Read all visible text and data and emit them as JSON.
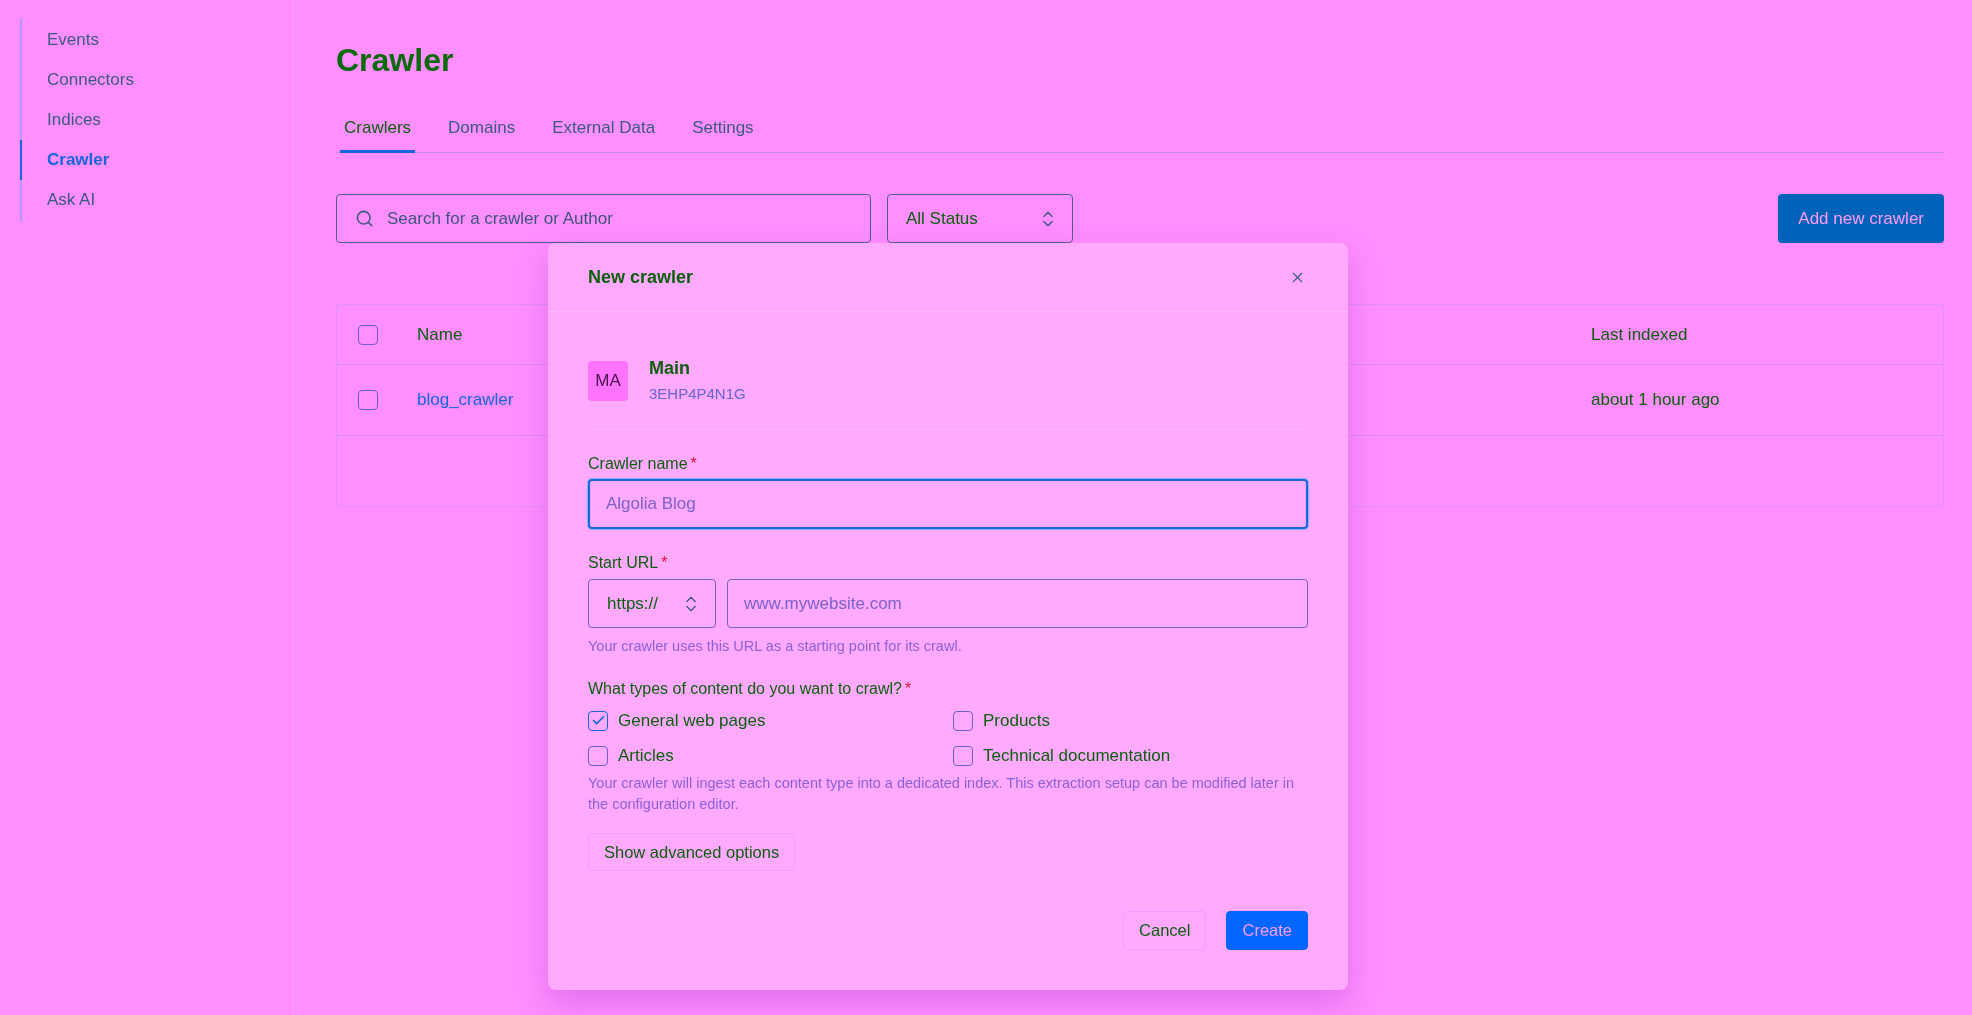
{
  "sidebar": {
    "items": [
      {
        "label": "Events",
        "selected": false
      },
      {
        "label": "Connectors",
        "selected": false
      },
      {
        "label": "Indices",
        "selected": false
      },
      {
        "label": "Crawler",
        "selected": true
      },
      {
        "label": "Ask AI",
        "selected": false
      }
    ]
  },
  "page": {
    "title": "Crawler"
  },
  "tabs": [
    {
      "label": "Crawlers",
      "selected": true
    },
    {
      "label": "Domains",
      "selected": false
    },
    {
      "label": "External Data",
      "selected": false
    },
    {
      "label": "Settings",
      "selected": false
    }
  ],
  "toolbar": {
    "search": {
      "placeholder": "Search for a crawler or Author"
    },
    "status_filter": {
      "value": "All Status"
    },
    "add_button": {
      "label": "Add new crawler"
    }
  },
  "table": {
    "select_all": {
      "checked": false
    },
    "columns": [
      "Name",
      "Last indexed"
    ],
    "rows": [
      {
        "checked": false,
        "name": "blog_crawler",
        "last_indexed": "about 1 hour ago"
      }
    ]
  },
  "modal": {
    "title": "New crawler",
    "account": {
      "initials": "MA",
      "name": "Main",
      "id": "3EHP4P4N1G"
    },
    "crawler_name": {
      "label": "Crawler name",
      "required_mark": "*",
      "placeholder": "Algolia Blog",
      "focused": true
    },
    "start_url": {
      "label": "Start URL",
      "required_mark": "*",
      "protocol": "https://",
      "placeholder": "www.mywebsite.com",
      "hint": "Your crawler uses this URL as a starting point for its crawl."
    },
    "content_types": {
      "label": "What types of content do you want to crawl?",
      "required_mark": "*",
      "options": [
        {
          "label": "General web pages",
          "checked": true
        },
        {
          "label": "Products",
          "checked": false
        },
        {
          "label": "Articles",
          "checked": false
        },
        {
          "label": "Technical documentation",
          "checked": false
        }
      ],
      "hint": "Your crawler will ingest each content type into a dedicated index. This extraction setup can be modified later in the configuration editor."
    },
    "advanced_button": {
      "label": "Show advanced options"
    },
    "actions": [
      {
        "label": "Cancel",
        "kind": "secondary"
      },
      {
        "label": "Create",
        "kind": "primary"
      }
    ]
  }
}
